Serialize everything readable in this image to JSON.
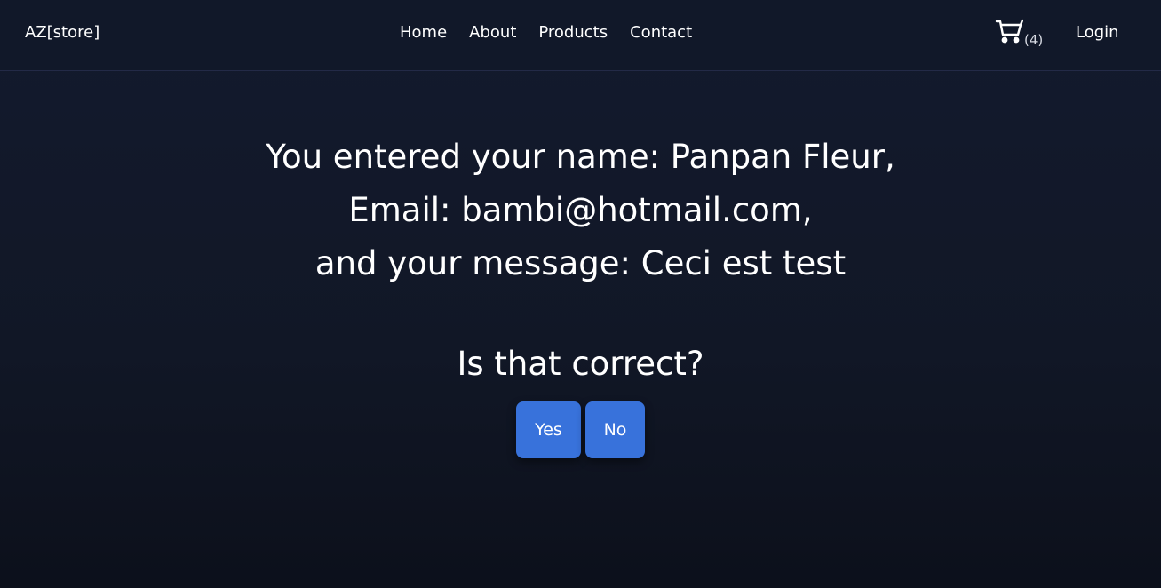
{
  "navbar": {
    "brand": "AZ[store]",
    "links": [
      "Home",
      "About",
      "Products",
      "Contact"
    ],
    "cart": {
      "icon": "cart-icon",
      "count": "(4)"
    },
    "login": "Login"
  },
  "confirmation": {
    "line1": "You entered your name: Panpan Fleur,",
    "line2": "Email: bambi@hotmail.com,",
    "line3": "and your message: Ceci est test",
    "question": "Is that correct?",
    "yes_label": "Yes",
    "no_label": "No"
  },
  "colors": {
    "background": "#111726",
    "button": "#3872db",
    "text": "#ffffff"
  }
}
